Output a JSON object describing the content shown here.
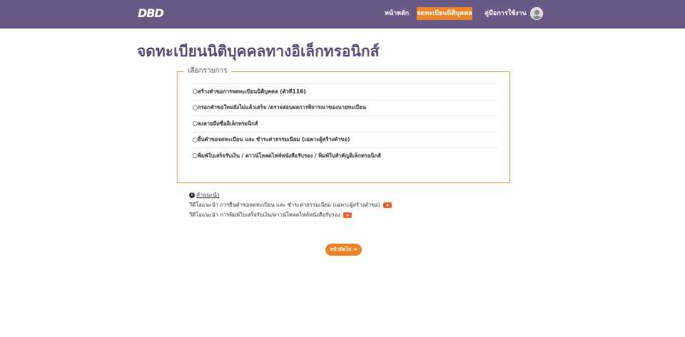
{
  "header": {
    "logo_text": "DBD",
    "nav": {
      "home": "หน้าหลัก",
      "register": "จดทะเบียนนิติบุคคล",
      "manual": "คู่มือการใช้งาน"
    },
    "avatar_icon": "user-avatar-icon"
  },
  "page_title": "จดทะเบียนนิติบุคคลทางอิเล็กทรอนิกส์",
  "selection": {
    "legend": "เลือกรายการ",
    "options": [
      "สร้างคำขอการจดทะเบียนนิติบุคคล (ตัวที่116)",
      "กรอกคำขอใหม่ยังไม่แล้วเสร็จ /ตรวจสอบผลการพิจารณาของนายทะเบียน",
      "ลงลายมือชื่ออิเล็กทรอนิกส์",
      "ยื่นคำขอจดทะเบียน และ ชำระค่าธรรมเนียม (เฉพาะผู้สร้างคำขอ)",
      "พิมพ์ใบเสร็จรับเงิน / ดาวน์โหลดไฟล์หนังสือรับรอง / พิมพ์ใบสำคัญอิเล็กทรอนิกส์"
    ]
  },
  "info": {
    "guide_link": "คำแนะนำ",
    "video1": "วีดีโอแนะนำ การยื่นคำขอจดทะเบียน และ ชำระค่าธรรมเนียม (เฉพาะผู้สร้างคำขอ)",
    "video2": "วีดีโอแนะนำ การพิมพ์ใบเสร็จรับเงิน/ดาวน์โหลดไฟล์หนังสือรับรอง"
  },
  "next_button": "หน้าถัดไป ➜",
  "colors": {
    "header_bg": "#6a5985",
    "accent": "#e8842a",
    "title": "#5c4a7a"
  }
}
